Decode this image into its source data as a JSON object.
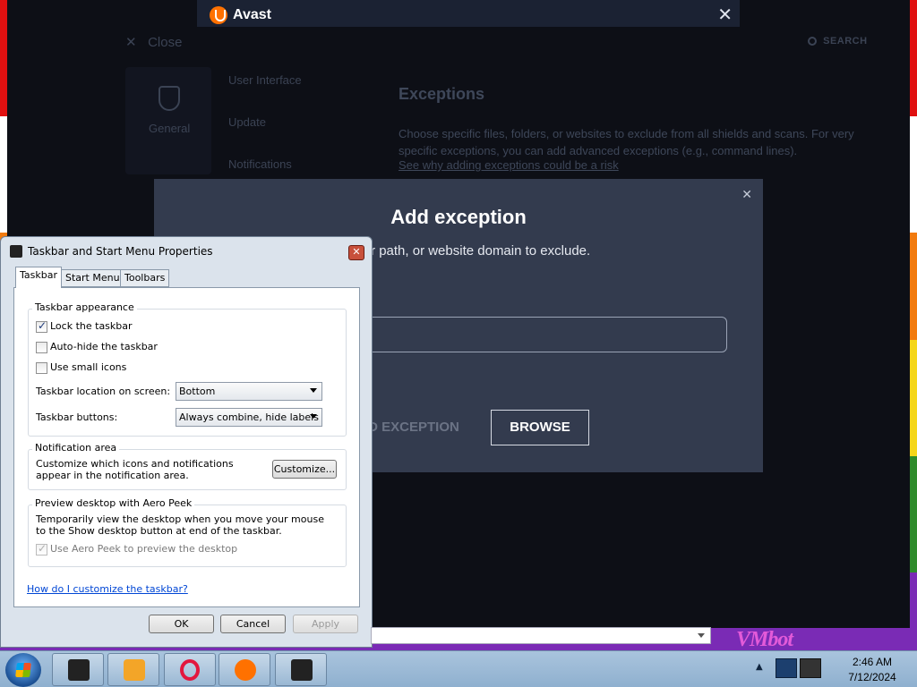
{
  "avast": {
    "title": "Avast",
    "close_label": "Close",
    "search_label": "SEARCH",
    "general_label": "General",
    "settings_items": [
      "User Interface",
      "Update",
      "Notifications"
    ],
    "exceptions_title": "Exceptions",
    "exceptions_desc": "Choose specific files, folders, or websites to exclude from all shields and scans. For very specific exceptions, you can add advanced exceptions (e.g., command lines).",
    "exceptions_link": "See why adding exceptions could be a risk",
    "close_glyph": "✕"
  },
  "add_exception": {
    "title": "Add exception",
    "subtitle": "n, folder path, or website domain to exclude.",
    "add_button": "D EXCEPTION",
    "browse_button": "BROWSE",
    "close_glyph": "✕"
  },
  "taskbar_props": {
    "title": "Taskbar and Start Menu Properties",
    "close_glyph": "✕",
    "tabs": [
      "Taskbar",
      "Start Menu",
      "Toolbars"
    ],
    "appearance": {
      "title": "Taskbar appearance",
      "lock": "Lock the taskbar",
      "lock_checked": true,
      "autohide": "Auto-hide the taskbar",
      "autohide_checked": false,
      "small_icons": "Use small icons",
      "small_icons_checked": false,
      "location_label": "Taskbar location on screen:",
      "location_value": "Bottom",
      "buttons_label": "Taskbar buttons:",
      "buttons_value": "Always combine, hide labels"
    },
    "notification": {
      "title": "Notification area",
      "desc": "Customize which icons and notifications appear in the notification area.",
      "customize_button": "Customize..."
    },
    "aero": {
      "title": "Preview desktop with Aero Peek",
      "desc": "Temporarily view the desktop when you move your mouse to the Show desktop button at end of the taskbar.",
      "checkbox": "Use Aero Peek to preview the desktop",
      "checked": true
    },
    "help_link": "How do I customize the taskbar?",
    "ok": "OK",
    "cancel": "Cancel",
    "apply": "Apply"
  },
  "taskbar": {
    "time": "2:46 AM",
    "date": "7/12/2024",
    "items": [
      "black-hat-app-icon",
      "media-player-icon",
      "opera-icon",
      "avast-icon",
      "black-hat-app-icon"
    ]
  },
  "watermark": "VMbot"
}
